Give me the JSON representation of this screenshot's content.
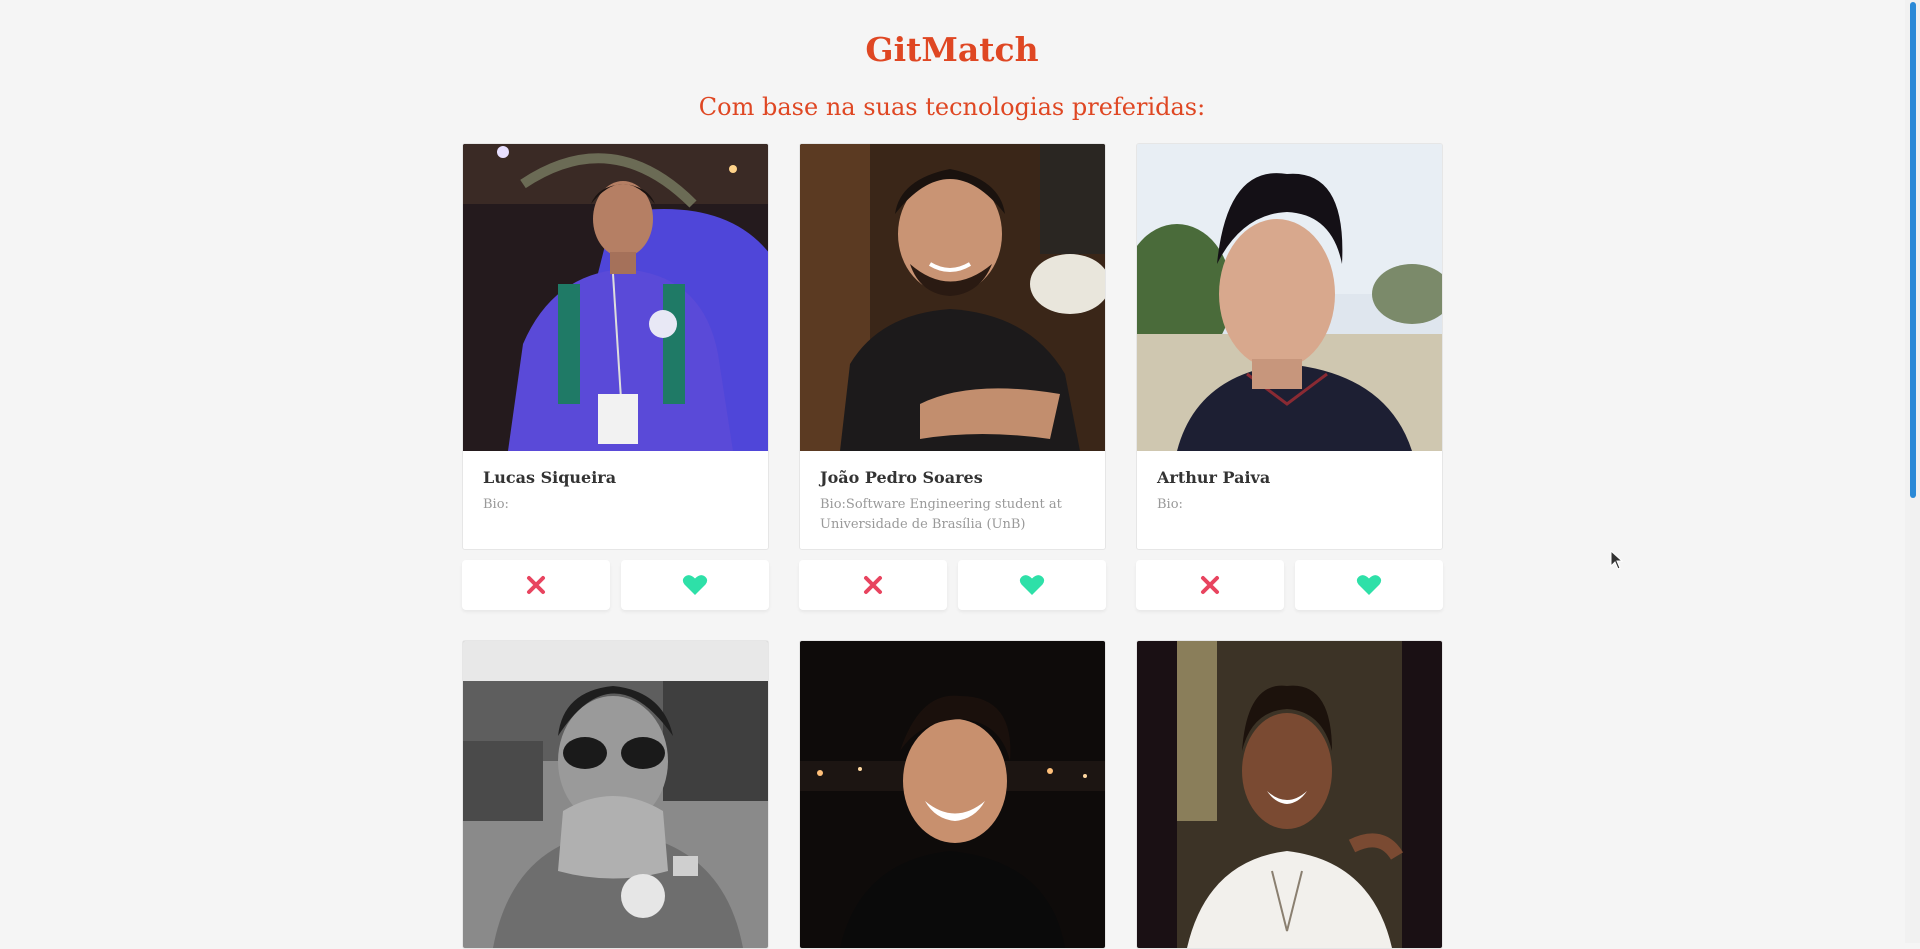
{
  "header": {
    "title": "GitMatch",
    "subtitle": "Com base na suas tecnologias preferidas:"
  },
  "colors": {
    "accent": "#df4723",
    "dislike": "#e8445f",
    "like": "#2ee0a8"
  },
  "icons": {
    "dislike": "close-icon",
    "like": "heart-icon"
  },
  "developers": [
    {
      "name": "Lucas Siqueira",
      "bio": "Bio:"
    },
    {
      "name": "João Pedro Soares",
      "bio": "Bio:Software Engineering student at Universidade de Brasília (UnB)"
    },
    {
      "name": "Arthur Paiva",
      "bio": "Bio:"
    },
    {
      "name": "",
      "bio": ""
    },
    {
      "name": "",
      "bio": ""
    },
    {
      "name": "",
      "bio": ""
    }
  ]
}
